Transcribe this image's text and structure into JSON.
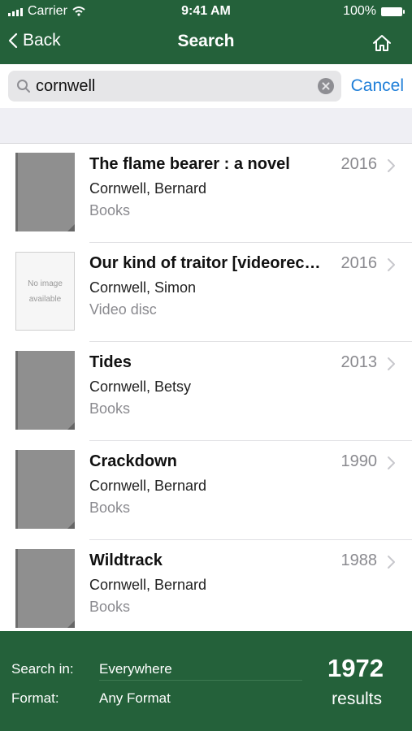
{
  "status": {
    "carrier": "Carrier",
    "time": "9:41 AM",
    "battery": "100%"
  },
  "nav": {
    "back_label": "Back",
    "title": "Search"
  },
  "search": {
    "value": "cornwell",
    "cancel_label": "Cancel"
  },
  "results": [
    {
      "title": "The flame bearer : a novel",
      "author": "Cornwell, Bernard",
      "format": "Books",
      "year": "2016",
      "cover": "gray"
    },
    {
      "title": "Our kind of traitor [videorecording]",
      "author": "Cornwell, Simon",
      "format": "Video disc",
      "year": "2016",
      "cover": "no-image",
      "cover_text_1": "No image",
      "cover_text_2": "available"
    },
    {
      "title": "Tides",
      "author": "Cornwell, Betsy",
      "format": "Books",
      "year": "2013",
      "cover": "gray"
    },
    {
      "title": "Crackdown",
      "author": "Cornwell, Bernard",
      "format": "Books",
      "year": "1990",
      "cover": "gray"
    },
    {
      "title": "Wildtrack",
      "author": "Cornwell, Bernard",
      "format": "Books",
      "year": "1988",
      "cover": "gray"
    }
  ],
  "footer": {
    "search_in_label": "Search in:",
    "search_in_value": "Everywhere",
    "format_label": "Format:",
    "format_value": "Any Format",
    "count": "1972",
    "results_label": "results"
  },
  "colors": {
    "header_green": "#24613a",
    "link_blue": "#1e7ed8"
  }
}
